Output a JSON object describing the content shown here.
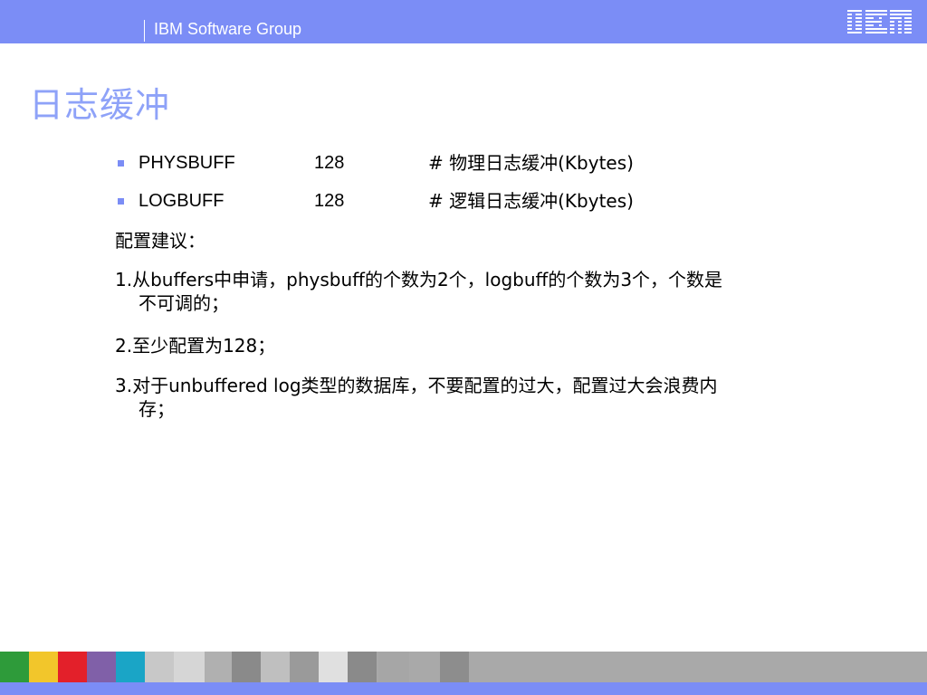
{
  "header": {
    "group_label": "IBM Software Group",
    "logo_text": "IBM",
    "colors": {
      "bar": "#7b8df6",
      "text": "#ffffff"
    }
  },
  "slide": {
    "title": "日志缓冲",
    "title_color": "#8ea2f8",
    "bullets": [
      {
        "key": "PHYSBUFF",
        "value": "128",
        "comment": "# 物理日志缓冲(Kbytes)"
      },
      {
        "key": "LOGBUFF",
        "value": "128",
        "comment": "# 逻辑日志缓冲(Kbytes)"
      }
    ],
    "paragraphs": {
      "heading": "配置建议：",
      "item1_line1": "1.从buffers中申请，physbuff的个数为2个，logbuff的个数为3个，个数是",
      "item1_line2": "不可调的；",
      "item2": "2.至少配置为128；",
      "item3_line1": "3.对于unbuffered log类型的数据库，不要配置的过大，配置过大会浪费内",
      "item3_line2": "存；"
    }
  },
  "footer": {
    "tile_colors": [
      "#2e9b3a",
      "#f2c62b",
      "#e3202a",
      "#8060a8",
      "#1aa5c6",
      "#c8c8c8",
      "#d6d6d6",
      "#b0b0b0",
      "#8a8a8a",
      "#bfbfbf",
      "#9a9a9a",
      "#e0e0e0",
      "#8a8a8a",
      "#a6a6a6",
      "#a9a9a9",
      "#8d8d8d",
      "#a9a9a9"
    ],
    "bar_color": "#7b8df6"
  }
}
